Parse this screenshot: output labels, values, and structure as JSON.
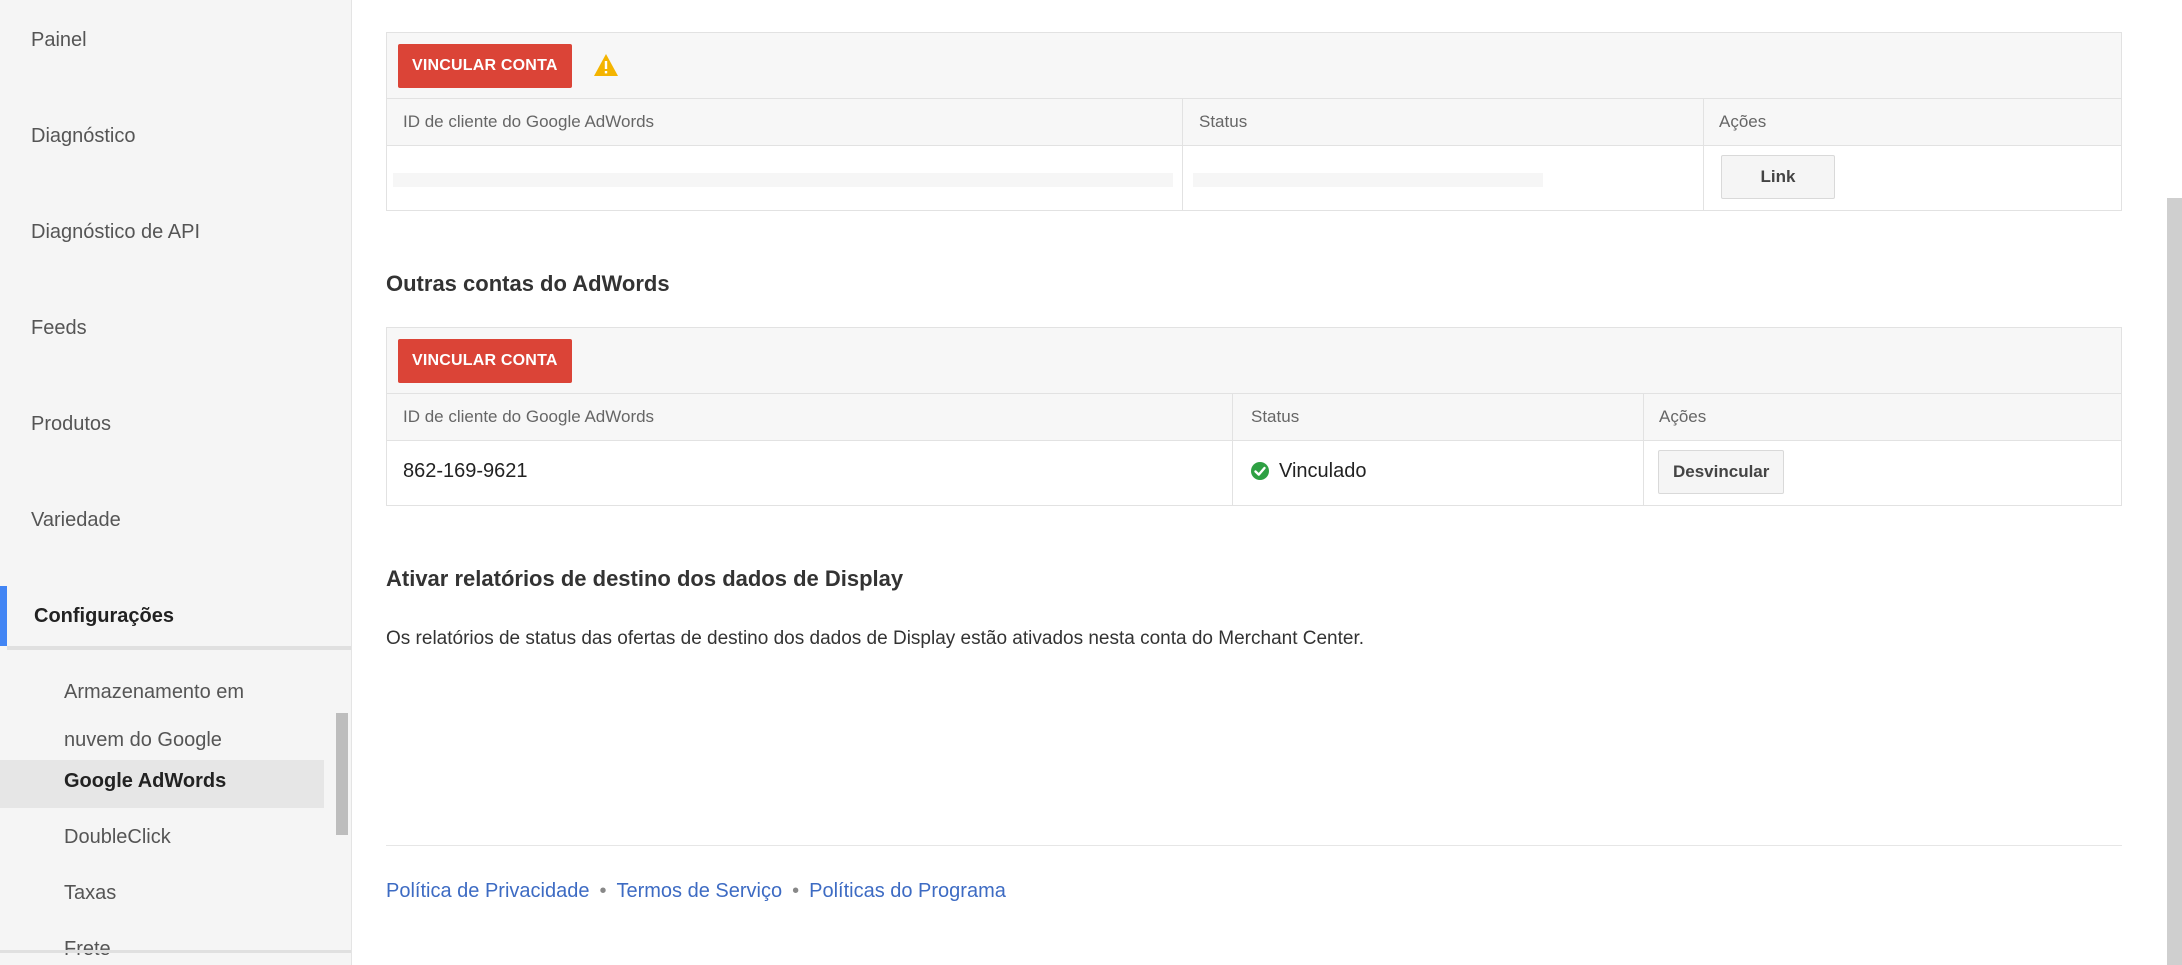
{
  "sidebar": {
    "items": [
      {
        "label": "Painel"
      },
      {
        "label": "Diagnóstico"
      },
      {
        "label": "Diagnóstico de API"
      },
      {
        "label": "Feeds"
      },
      {
        "label": "Produtos"
      },
      {
        "label": "Variedade"
      },
      {
        "label": "Configurações"
      }
    ],
    "sub_items": [
      {
        "label_line1": "Armazenamento em",
        "label_line2": "nuvem do Google"
      },
      {
        "label": "Google AdWords"
      },
      {
        "label": "DoubleClick"
      },
      {
        "label": "Taxas"
      },
      {
        "label": "Frete"
      }
    ]
  },
  "top_panel": {
    "link_button": "VINCULAR CONTA",
    "columns": [
      "ID de cliente do Google AdWords",
      "Status",
      "Ações"
    ],
    "row_action": "Link"
  },
  "other_accounts": {
    "title": "Outras contas do AdWords",
    "link_button": "VINCULAR CONTA",
    "columns": [
      "ID de cliente do Google AdWords",
      "Status",
      "Ações"
    ],
    "rows": [
      {
        "id": "862-169-9621",
        "status": "Vinculado",
        "action": "Desvincular"
      }
    ]
  },
  "display_reports": {
    "title": "Ativar relatórios de destino dos dados de Display",
    "text": "Os relatórios de status das ofertas de destino dos dados de Display estão ativados nesta conta do Merchant Center."
  },
  "footer": {
    "links": [
      "Política de Privacidade",
      "Termos de Serviço",
      "Políticas do Programa"
    ],
    "separator": "•"
  },
  "colors": {
    "accent_blue": "#4285f4",
    "button_red": "#db4437",
    "link_blue": "#3d6bc3",
    "status_green": "#2ea043",
    "warning_yellow": "#f4b400"
  }
}
